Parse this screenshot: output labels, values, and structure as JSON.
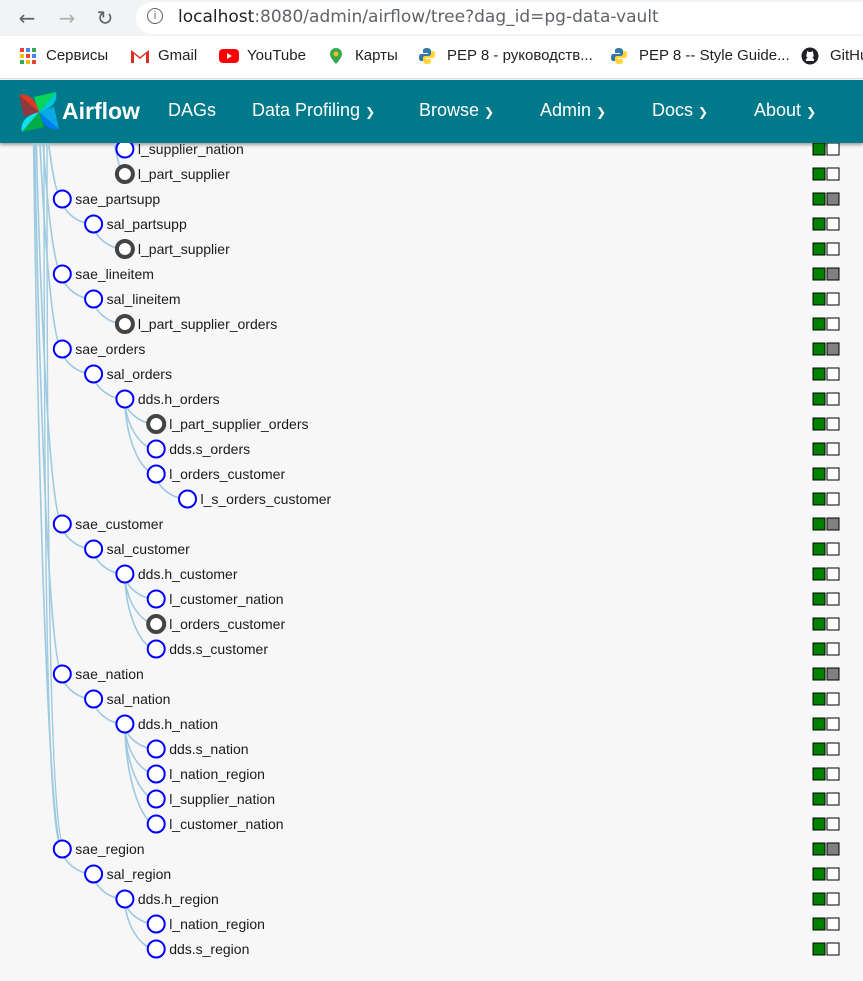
{
  "browser": {
    "url_host": "localhost",
    "url_rest": ":8080/admin/airflow/tree?dag_id=pg-data-vault",
    "bookmarks": [
      "Сервисы",
      "Gmail",
      "YouTube",
      "Карты",
      "PEP 8 - руководств...",
      "PEP 8 -- Style Guide...",
      "GitHub"
    ]
  },
  "navbar": {
    "brand": "Airflow",
    "items": [
      "DAGs",
      "Data Profiling",
      "Browse",
      "Admin",
      "Docs",
      "About"
    ],
    "color": "#00798b"
  },
  "tree": {
    "nodes": [
      {
        "label": "l_supplier_nation",
        "depth": 3,
        "type": "task",
        "state2": "white"
      },
      {
        "label": "l_part_supplier",
        "depth": 3,
        "type": "dummy",
        "state2": "white"
      },
      {
        "label": "sae_partsupp",
        "depth": 1,
        "type": "task",
        "state2": "gray"
      },
      {
        "label": "sal_partsupp",
        "depth": 2,
        "type": "task",
        "state2": "white"
      },
      {
        "label": "l_part_supplier",
        "depth": 3,
        "type": "dummy",
        "state2": "white"
      },
      {
        "label": "sae_lineitem",
        "depth": 1,
        "type": "task",
        "state2": "gray"
      },
      {
        "label": "sal_lineitem",
        "depth": 2,
        "type": "task",
        "state2": "white"
      },
      {
        "label": "l_part_supplier_orders",
        "depth": 3,
        "type": "dummy",
        "state2": "white"
      },
      {
        "label": "sae_orders",
        "depth": 1,
        "type": "task",
        "state2": "gray"
      },
      {
        "label": "sal_orders",
        "depth": 2,
        "type": "task",
        "state2": "white"
      },
      {
        "label": "dds.h_orders",
        "depth": 3,
        "type": "task",
        "state2": "white"
      },
      {
        "label": "l_part_supplier_orders",
        "depth": 4,
        "type": "dummy",
        "state2": "white"
      },
      {
        "label": "dds.s_orders",
        "depth": 4,
        "type": "task",
        "state2": "white"
      },
      {
        "label": "l_orders_customer",
        "depth": 4,
        "type": "task",
        "state2": "white"
      },
      {
        "label": "l_s_orders_customer",
        "depth": 5,
        "type": "task",
        "state2": "white"
      },
      {
        "label": "sae_customer",
        "depth": 1,
        "type": "task",
        "state2": "gray"
      },
      {
        "label": "sal_customer",
        "depth": 2,
        "type": "task",
        "state2": "white"
      },
      {
        "label": "dds.h_customer",
        "depth": 3,
        "type": "task",
        "state2": "white"
      },
      {
        "label": "l_customer_nation",
        "depth": 4,
        "type": "task",
        "state2": "white"
      },
      {
        "label": "l_orders_customer",
        "depth": 4,
        "type": "dummy",
        "state2": "white"
      },
      {
        "label": "dds.s_customer",
        "depth": 4,
        "type": "task",
        "state2": "white"
      },
      {
        "label": "sae_nation",
        "depth": 1,
        "type": "task",
        "state2": "gray"
      },
      {
        "label": "sal_nation",
        "depth": 2,
        "type": "task",
        "state2": "white"
      },
      {
        "label": "dds.h_nation",
        "depth": 3,
        "type": "task",
        "state2": "white"
      },
      {
        "label": "dds.s_nation",
        "depth": 4,
        "type": "task",
        "state2": "white"
      },
      {
        "label": "l_nation_region",
        "depth": 4,
        "type": "task",
        "state2": "white"
      },
      {
        "label": "l_supplier_nation",
        "depth": 4,
        "type": "task",
        "state2": "white"
      },
      {
        "label": "l_customer_nation",
        "depth": 4,
        "type": "task",
        "state2": "white"
      },
      {
        "label": "sae_region",
        "depth": 1,
        "type": "task",
        "state2": "gray"
      },
      {
        "label": "sal_region",
        "depth": 2,
        "type": "task",
        "state2": "white"
      },
      {
        "label": "dds.h_region",
        "depth": 3,
        "type": "task",
        "state2": "white"
      },
      {
        "label": "l_nation_region",
        "depth": 4,
        "type": "task",
        "state2": "white"
      },
      {
        "label": "dds.s_region",
        "depth": 4,
        "type": "task",
        "state2": "white"
      }
    ],
    "colors": {
      "success": "#008000",
      "gray": "#808080",
      "node_stroke": "#0000ff",
      "dummy_stroke": "#444444",
      "link": "#9ecae1"
    }
  }
}
